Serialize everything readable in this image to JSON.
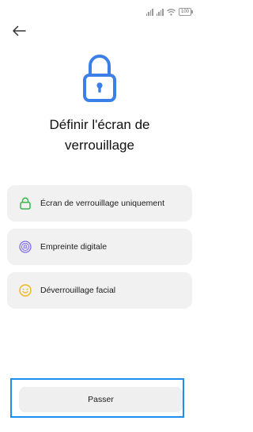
{
  "status_bar": {
    "battery": "100",
    "signal_icon": "signal-icon",
    "wifi_icon": "wifi-icon"
  },
  "header": {
    "back_icon": "arrow-left-icon"
  },
  "main": {
    "title": "Définir l'écran de\nverrouillage",
    "hero_icon": "padlock-icon",
    "options": [
      {
        "label": "Écran de verrouillage uniquement",
        "icon": "lock-icon",
        "color": "#3ab54a"
      },
      {
        "label": "Empreinte digitale",
        "icon": "fingerprint-icon",
        "color": "#7b6cf0"
      },
      {
        "label": "Déverrouillage facial",
        "icon": "face-icon",
        "color": "#f2b418"
      }
    ]
  },
  "footer": {
    "skip_label": "Passer"
  },
  "colors": {
    "accent": "#3b7fe8",
    "focus_ring": "#1c8ef0"
  }
}
